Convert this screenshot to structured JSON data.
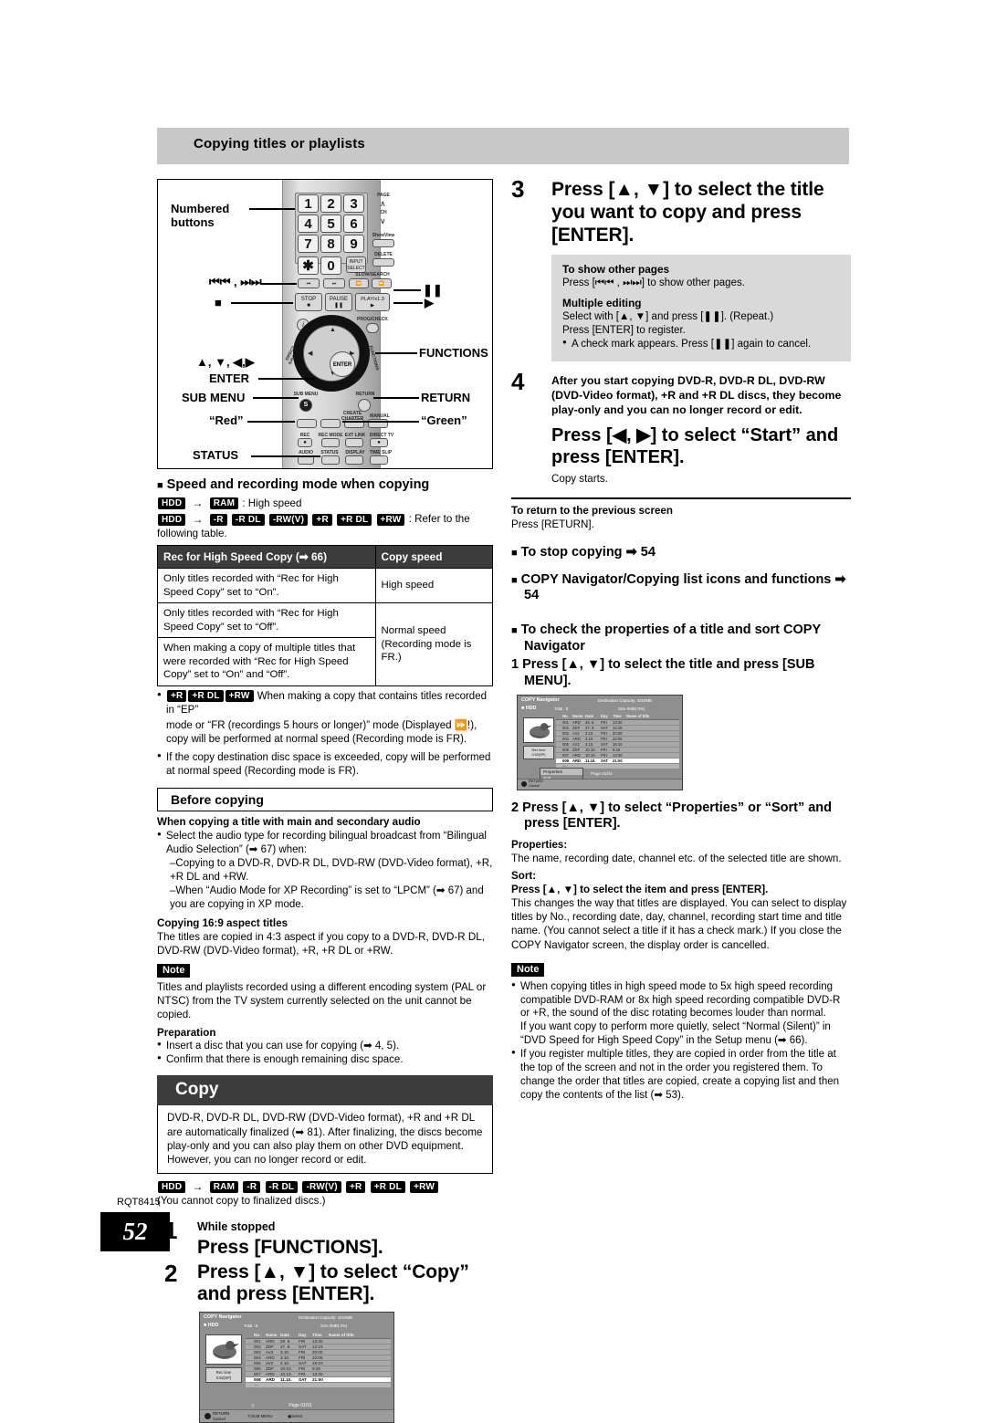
{
  "header": {
    "title": "Copying titles or playlists"
  },
  "remote": {
    "callouts": {
      "numbered": "Numbered\nbuttons",
      "numbered_l1": "Numbered",
      "numbered_l2": "buttons",
      "skip": "⏮⏮ ,  ⏭⏭",
      "stop": "■",
      "pause": "❚❚",
      "play": "▶",
      "functions": "FUNCTIONS",
      "cursor": "▲, ▼, ◀,▶",
      "enter": "ENTER",
      "submenu": "SUB MENU",
      "return": "RETURN",
      "red": "“Red”",
      "green": "“Green”",
      "status": "STATUS"
    },
    "keys": {
      "n1": "1",
      "n2": "2",
      "n3": "3",
      "n4": "4",
      "n5": "5",
      "n6": "6",
      "n7": "7",
      "n8": "8",
      "n9": "9",
      "star": "✱",
      "n0": "0",
      "input_select": "INPUT\nSELECT",
      "page": "PAGE",
      "ch": "CH",
      "showview": "ShowView",
      "delete": "DELETE",
      "slowsearch": "SLOW/SEARCH",
      "stop": "STOP",
      "pause": "PAUSE",
      "play": "PLAY/x1.3",
      "progcheck": "PROG/CHECK",
      "guide": "GUIDE",
      "direct_navigator": "DIRECT NAVIGATOR",
      "functions": "FUNCTIONS",
      "enter": "ENTER",
      "submenu_label": "SUB MENU",
      "submenu_glyph": "S",
      "return": "RETURN",
      "create_chapter": "CREATE\nCHAPTER",
      "manual_skip": "MANUAL SKIP",
      "rec": "REC",
      "rec_mode": "REC MODE",
      "ext_link": "EXT LINK",
      "direct_tv_rec": "DIRECT TV REC",
      "audio": "AUDIO",
      "status": "STATUS",
      "display": "DISPLAY",
      "time_slip": "TIME SLIP"
    }
  },
  "speed_section": {
    "heading": "Speed and recording mode when copying",
    "line1": {
      "from": "HDD",
      "to": "RAM",
      "text": ": High speed"
    },
    "line2": {
      "from": "HDD",
      "badges": [
        "-R",
        "-R DL",
        "-RW(V)",
        "+R",
        "+R DL",
        "+RW"
      ],
      "text": ": Refer to the following table."
    },
    "table": {
      "headers": [
        "Rec for High Speed Copy (➡ 66)",
        "Copy speed"
      ],
      "rows": [
        {
          "cond": "Only titles recorded with “Rec for High Speed Copy” set to “On”.",
          "speed": "High speed"
        },
        {
          "cond": "Only titles recorded with “Rec for High Speed Copy” set to “Off”.",
          "speed": "Normal speed (Recording mode is FR.)"
        },
        {
          "cond": "When making a copy of multiple titles that were recorded with “Rec for High Speed Copy” set to “On” and “Off”.",
          "speed": ""
        }
      ]
    },
    "bullets": [
      {
        "badges": [
          "+R",
          "+R DL",
          "+RW"
        ],
        "text": "When making a copy that contains titles recorded in “EP”"
      },
      {
        "text": "mode or “FR (recordings 5 hours or longer)” mode (Displayed ⏩!), copy will be performed at normal speed (Recording mode is FR)."
      },
      {
        "text": "If the copy destination disc space is exceeded, copy will be performed at normal speed (Recording mode is FR)."
      }
    ]
  },
  "before_copying": {
    "boxhead": "Before copying",
    "sub1": "When copying a title with main and secondary audio",
    "b1": "Select the audio type for recording bilingual broadcast from “Bilingual Audio Selection” (➡ 67) when:",
    "d1": "–Copying to a DVD-R, DVD-R DL, DVD-RW (DVD-Video format), +R, +R DL and +RW.",
    "d2": "–When “Audio Mode for XP Recording” is set to “LPCM” (➡ 67) and you are copying in XP mode.",
    "sub2": "Copying 16:9 aspect titles",
    "p2": "The titles are copied in 4:3 aspect if you copy to a DVD-R, DVD-R DL, DVD-RW (DVD-Video format), +R, +R DL or +RW.",
    "note_tag": "Note",
    "note_text": "Titles and playlists recorded using a different encoding system (PAL or NTSC) from the TV system currently selected on the unit cannot be copied.",
    "prep_head": "Preparation",
    "prep1": "Insert a disc that you can use for copying (➡ 4, 5).",
    "prep2": "Confirm that there is enough remaining disc space."
  },
  "copy_section": {
    "bar_title": "Copy",
    "box_text": "DVD-R, DVD-R DL, DVD-RW (DVD-Video format), +R and +R DL are automatically finalized (➡ 81). After finalizing, the discs become play-only and you can also play them on other DVD equipment. However, you can no longer record or edit.",
    "badges_from": "HDD",
    "badges": [
      "RAM",
      "-R",
      "-R DL",
      "-RW(V)",
      "+R",
      "+R DL",
      "+RW"
    ],
    "badges_note": "(You cannot copy to finalized discs.)",
    "step1": {
      "num": "1",
      "small": "While stopped",
      "big": "Press [FUNCTIONS]."
    },
    "step2": {
      "num": "2",
      "big": "Press [▲, ▼] to select “Copy” and press [ENTER]."
    }
  },
  "right": {
    "step3": {
      "num": "3",
      "big": "Press [▲, ▼] to select the title you want to copy and press [ENTER]."
    },
    "greybox": {
      "h1": "To show other pages",
      "l1": "Press [⏮⏮ , ⏭⏭] to show other pages.",
      "h2": "Multiple editing",
      "l2": "Select with [▲, ▼] and press [❚❚]. (Repeat.)",
      "l3": "Press [ENTER] to register.",
      "l4": "A check mark appears. Press [❚❚] again to cancel."
    },
    "step4": {
      "num": "4",
      "small": "After you start copying DVD-R, DVD-R DL, DVD-RW (DVD-Video format), +R and +R DL discs, they become play-only and you can no longer record or edit.",
      "big": "Press [◀, ▶] to select “Start” and press [ENTER].",
      "after": "Copy starts."
    },
    "return_head": "To return to the previous screen",
    "return_text": "Press [RETURN].",
    "sq1": "To stop copying ➡ 54",
    "sq2": "COPY Navigator/Copying list icons and functions ➡ 54",
    "sq3": "To check the properties of a title and sort COPY Navigator",
    "sub_step1": "1  Press [▲, ▼] to select the title and press [SUB MENU].",
    "sub_step2": "2  Press [▲, ▼] to select “Properties” or “Sort” and press [ENTER].",
    "prop_head": "Properties:",
    "prop_text": "The name, recording date, channel etc. of the selected title are shown.",
    "sort_head": "Sort:",
    "sort_bold": "Press [▲, ▼] to select the item and press [ENTER].",
    "sort_text": "This changes the way that titles are displayed. You can select to display titles by No., recording date, day, channel, recording start time and title name. (You cannot select a title if it has a check mark.) If you close the COPY Navigator screen, the display order is cancelled.",
    "note_tag": "Note",
    "note1": "When copying titles in high speed mode to 5x high speed recording compatible DVD-RAM or 8x high speed recording compatible DVD-R or +R, the sound of the disc rotating becomes louder than normal.",
    "note1b": "If you want copy to perform more quietly, select “Normal (Silent)” in “DVD Speed for High Speed Copy” in the Setup menu (➡ 66).",
    "note2": "If you register multiple titles, they are copied in order from the title at the top of the screen and not in the order you registered them. To change the order that titles are copied, create a copying list and then copy the contents of the list (➡ 53)."
  },
  "osd": {
    "title": "COPY Navigator",
    "source": "HDD",
    "total": "Total :   8",
    "dest_cap": "Destination Capacity:  4310MB",
    "size": "Size        0MB(  0%)",
    "rec_time_l1": "Rec time",
    "rec_time_l2": "0:52(SP)",
    "columns": [
      "",
      "No.",
      "Name",
      "Date",
      "Day",
      "Time",
      "Name of title"
    ],
    "rows": [
      {
        "no": "001",
        "name": "ARD",
        "date": "26. 9.",
        "day": "FRI",
        "time": "13:30",
        "title": ""
      },
      {
        "no": "002",
        "name": "ZDF",
        "date": "27. 9.",
        "day": "SAT",
        "time": "12:15",
        "title": ""
      },
      {
        "no": "003",
        "name": "AV2",
        "date": "3.10.",
        "day": "FRI",
        "time": "20:00",
        "title": ""
      },
      {
        "no": "004",
        "name": "ARD",
        "date": "3.10.",
        "day": "FRI",
        "time": "22:05",
        "title": ""
      },
      {
        "no": "005",
        "name": "AV2",
        "date": "4.10.",
        "day": "SAT",
        "time": "16:10",
        "title": ""
      },
      {
        "no": "006",
        "name": "ZDF",
        "date": "10.10.",
        "day": "FRI",
        "time": "9:25",
        "title": ""
      },
      {
        "no": "007",
        "name": "ARD",
        "date": "10.10.",
        "day": "FRI",
        "time": "13:30",
        "title": ""
      },
      {
        "no": "008",
        "name": "ARD",
        "date": "11.10.",
        "day": "SAT",
        "time": "21:00",
        "title": ""
      }
    ],
    "page": "Page 01/01",
    "footer": {
      "f1": "RETURN",
      "f1b": "Cancel",
      "f2": "SUB MENU",
      "f3": "Select"
    },
    "submenu": {
      "item1": "Properties",
      "item2": "Sort"
    }
  },
  "footer": {
    "rqt": "RQT8415",
    "page": "52"
  }
}
